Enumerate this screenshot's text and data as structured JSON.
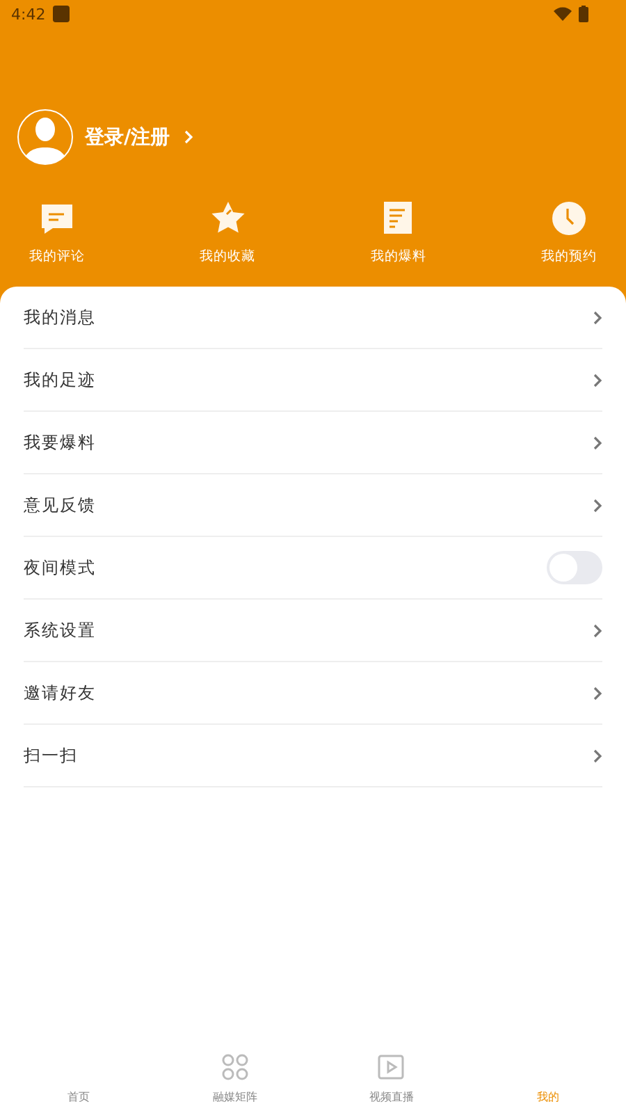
{
  "status_bar": {
    "time": "4:42"
  },
  "profile": {
    "login_label": "登录/注册"
  },
  "shortcuts": [
    {
      "label": "我的评论",
      "kind": "comment"
    },
    {
      "label": "我的收藏",
      "kind": "star"
    },
    {
      "label": "我的爆料",
      "kind": "document"
    },
    {
      "label": "我的预约",
      "kind": "clock"
    }
  ],
  "menu": [
    {
      "label": "我的消息",
      "kind": "link"
    },
    {
      "label": "我的足迹",
      "kind": "link"
    },
    {
      "label": "我要爆料",
      "kind": "link"
    },
    {
      "label": "意见反馈",
      "kind": "link"
    },
    {
      "label": "夜间模式",
      "kind": "toggle",
      "on": false
    },
    {
      "label": "系统设置",
      "kind": "link"
    },
    {
      "label": "邀请好友",
      "kind": "link"
    },
    {
      "label": "扫一扫",
      "kind": "link"
    }
  ],
  "tab_bar": [
    {
      "label": "首页",
      "kind": "plain",
      "selected": false
    },
    {
      "label": "融媒矩阵",
      "kind": "grid",
      "selected": false
    },
    {
      "label": "视频直播",
      "kind": "play",
      "selected": false
    },
    {
      "label": "我的",
      "kind": "plain",
      "selected": true
    }
  ]
}
